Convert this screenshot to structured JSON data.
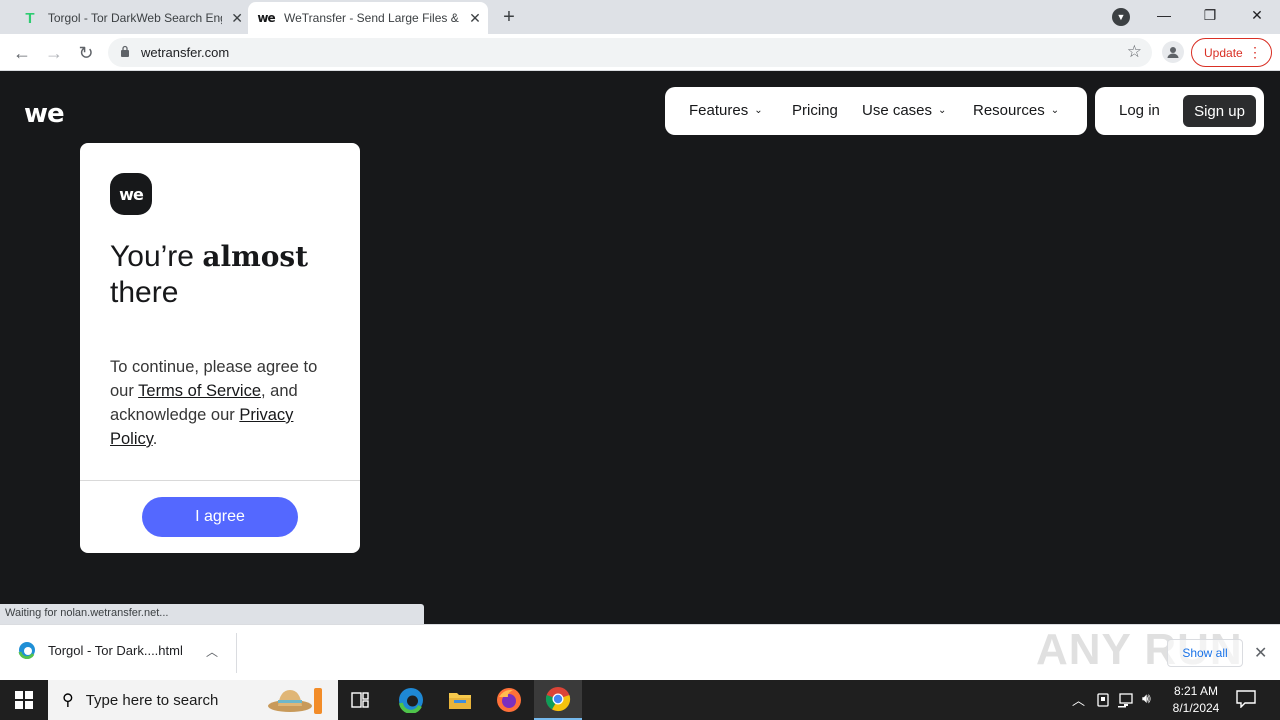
{
  "browser": {
    "tabs": [
      {
        "title": "Torgol - Tor DarkWeb Search Engine",
        "favicon": "T",
        "active": false
      },
      {
        "title": "WeTransfer - Send Large Files & Share Photos",
        "favicon": "we",
        "active": true
      }
    ],
    "new_tab": "+",
    "window_controls": {
      "minimize": "—",
      "restore": "❐",
      "close": "✕"
    },
    "url": "wetransfer.com",
    "update_label": "Update"
  },
  "site": {
    "logo": "we",
    "nav": {
      "features": "Features",
      "pricing": "Pricing",
      "use_cases": "Use cases",
      "resources": "Resources"
    },
    "login": "Log in",
    "signup": "Sign up"
  },
  "consent": {
    "logo": "we",
    "heading_pre": "You’re ",
    "heading_bold": "almost",
    "heading_post": "there",
    "text_1": "To continue, please agree to our ",
    "terms_link": "Terms of Service",
    "text_2": ", and acknowledge our ",
    "privacy_link": "Privacy Policy",
    "text_3": ".",
    "agree_button": "I agree",
    "button_color": "#5468ff"
  },
  "status_text": "Waiting for nolan.wetransfer.net...",
  "downloads": {
    "item_name": "Torgol - Tor Dark....html",
    "show_all": "Show all",
    "watermark": "ANY RUN"
  },
  "taskbar": {
    "search_placeholder": "Type here to search",
    "time": "8:21 AM",
    "date": "8/1/2024"
  }
}
